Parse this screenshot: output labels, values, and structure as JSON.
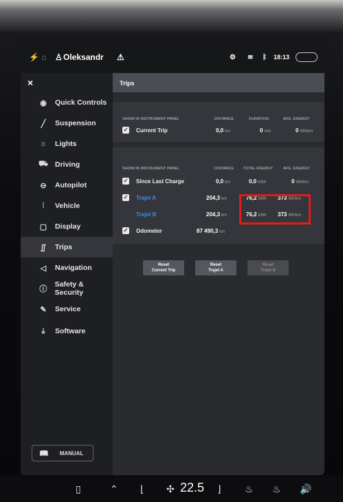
{
  "statusbar": {
    "user": "Oleksandr",
    "time": "18:13"
  },
  "sidebar": {
    "close": "×",
    "items": [
      {
        "label": "Quick Controls",
        "icon": "quick-controls-icon",
        "glyph": "◉"
      },
      {
        "label": "Suspension",
        "icon": "suspension-icon",
        "glyph": "╱"
      },
      {
        "label": "Lights",
        "icon": "lights-icon",
        "glyph": "☼"
      },
      {
        "label": "Driving",
        "icon": "driving-icon",
        "glyph": "⛟"
      },
      {
        "label": "Autopilot",
        "icon": "autopilot-icon",
        "glyph": "⊖"
      },
      {
        "label": "Vehicle",
        "icon": "vehicle-icon",
        "glyph": "⫶"
      },
      {
        "label": "Display",
        "icon": "display-icon",
        "glyph": "▢"
      },
      {
        "label": "Trips",
        "icon": "trips-icon",
        "glyph": "∬"
      },
      {
        "label": "Navigation",
        "icon": "navigation-icon",
        "glyph": "◁"
      },
      {
        "label": "Safety & Security",
        "icon": "safety-icon",
        "glyph": "ⓘ"
      },
      {
        "label": "Service",
        "icon": "service-icon",
        "glyph": "✎"
      },
      {
        "label": "Software",
        "icon": "software-icon",
        "glyph": "⤓"
      }
    ],
    "manual": "MANUAL"
  },
  "content": {
    "title": "Trips",
    "section1": {
      "headers": [
        "SHOW IN INSTRUMENT PANEL",
        "DISTANCE",
        "DURATION",
        "AVG. ENERGY"
      ],
      "rows": [
        {
          "label": "Current Trip",
          "distance": "0,0",
          "distance_unit": "km",
          "duration": "0",
          "duration_unit": "min",
          "avg": "0",
          "avg_unit": "Wh/km"
        }
      ]
    },
    "section2": {
      "headers": [
        "SHOW IN INSTRUMENT PANEL",
        "DISTANCE",
        "TOTAL ENERGY",
        "AVG. ENERGY"
      ],
      "rows": [
        {
          "label": "Since Last Charge",
          "distance": "0,0",
          "distance_unit": "km",
          "energy": "0,0",
          "energy_unit": "kWh",
          "avg": "0",
          "avg_unit": "Wh/km"
        },
        {
          "label": "Trajet A",
          "distance": "204,3",
          "distance_unit": "km",
          "energy": "76,2",
          "energy_unit": "kWh",
          "avg": "373",
          "avg_unit": "Wh/km"
        },
        {
          "label": "Trajet B",
          "distance": "204,3",
          "distance_unit": "km",
          "energy": "76,2",
          "energy_unit": "kWh",
          "avg": "373",
          "avg_unit": "Wh/km"
        },
        {
          "label": "Odometer",
          "distance": "87 490,3",
          "distance_unit": "km"
        }
      ]
    },
    "buttons": [
      {
        "line1": "Reset",
        "line2": "Current Trip"
      },
      {
        "line1": "Reset",
        "line2": "Trajet A"
      },
      {
        "line1": "Reset",
        "line2": "Trajet B"
      }
    ]
  },
  "dock": {
    "temperature": "22.5"
  },
  "colors": {
    "accent_blue": "#3b8fe8",
    "highlight_red": "#e31b1b",
    "active_green": "#2ecc71"
  }
}
